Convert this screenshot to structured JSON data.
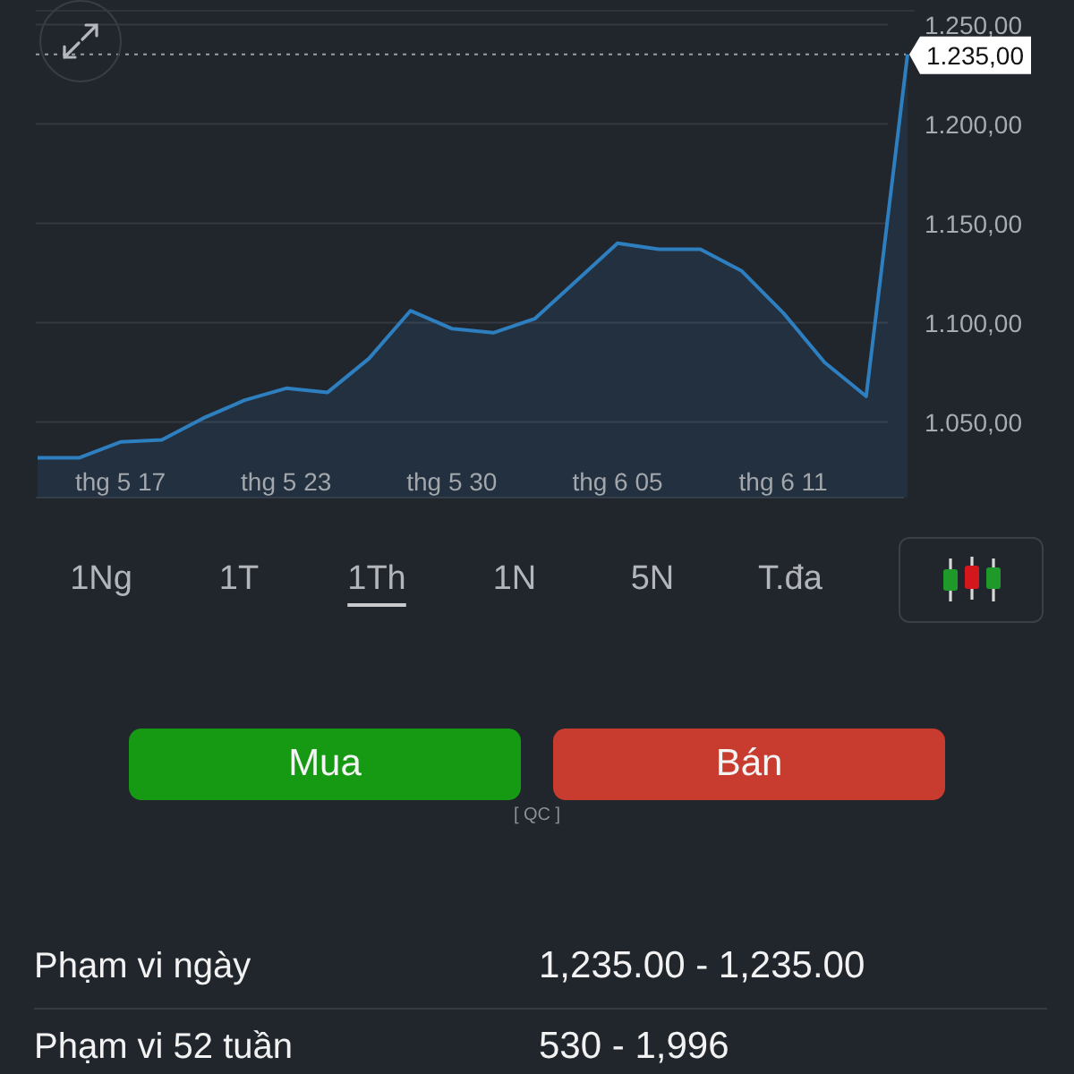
{
  "chart": {
    "chart_data": {
      "type": "area",
      "grid": true,
      "categories": [
        null,
        null,
        "thg 5 17",
        null,
        null,
        null,
        "thg 5 23",
        null,
        null,
        null,
        "thg 5 30",
        null,
        null,
        null,
        "thg 6 05",
        null,
        null,
        null,
        "thg 6 11",
        null,
        null,
        null
      ],
      "series": [
        {
          "color": "#2e7fc0",
          "values": [
            1032,
            1032,
            1040,
            1041,
            1052,
            1061,
            1067,
            1065,
            1082,
            1106,
            1097,
            1095,
            1102,
            1121,
            1140,
            1137,
            1137,
            1126,
            1105,
            1080,
            1063,
            1235
          ]
        }
      ],
      "ylim": [
        1012,
        1257
      ],
      "yticks": [
        {
          "value": 1050,
          "label": "1.050,00"
        },
        {
          "value": 1100,
          "label": "1.100,00"
        },
        {
          "value": 1150,
          "label": "1.150,00"
        },
        {
          "value": 1200,
          "label": "1.200,00"
        },
        {
          "value": 1250,
          "label": "1.250,00"
        }
      ]
    },
    "current_price": "1.235,00"
  },
  "ranges": [
    {
      "label": "1Ng",
      "selected": false
    },
    {
      "label": "1T",
      "selected": false
    },
    {
      "label": "1Th",
      "selected": true
    },
    {
      "label": "1N",
      "selected": false
    },
    {
      "label": "5N",
      "selected": false
    },
    {
      "label": "T.đa",
      "selected": false
    }
  ],
  "actions": [
    {
      "label": "Mua",
      "kind": "buy"
    },
    {
      "label": "Bán",
      "kind": "sell"
    }
  ],
  "ad_label": "[ QC ]",
  "stats": [
    {
      "label": "Phạm vi ngày",
      "value": "1,235.00 - 1,235.00"
    },
    {
      "label": "Phạm vi 52 tuần",
      "value": "530 - 1,996"
    }
  ]
}
